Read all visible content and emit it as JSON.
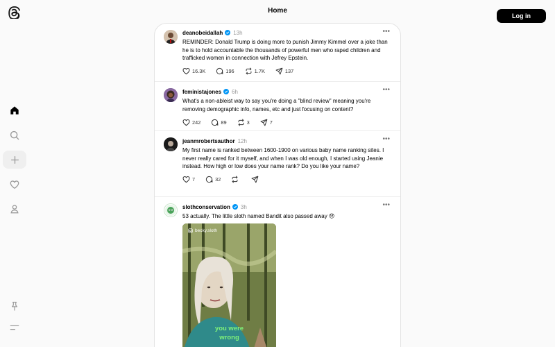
{
  "header": {
    "title": "Home",
    "login_label": "Log in"
  },
  "rail": {
    "icons": [
      "threads-logo-icon",
      "home-icon",
      "search-icon",
      "create-icon",
      "heart-icon",
      "profile-icon",
      "pin-icon",
      "menu-icon"
    ]
  },
  "posts": [
    {
      "username": "deanobeidallah",
      "verified": true,
      "time": "13h",
      "text": "REMINDER: Donald Trump is doing more to punish Jimmy Kimmel over a joke than he is to hold accountable the thousands of powerful men who raped children and trafficked women in connection with Jefrey Epstein.",
      "likes": "16.3K",
      "replies": "196",
      "reposts": "1.7K",
      "shares": "137"
    },
    {
      "username": "feministajones",
      "verified": true,
      "time": "6h",
      "text": "What's a non-ableist way to say you're doing a \"blind review\" meaning you're removing demographic info, names, etc and just focusing on content?",
      "likes": "242",
      "replies": "89",
      "reposts": "3",
      "shares": "7"
    },
    {
      "username": "jeanmrobertsauthor",
      "verified": false,
      "time": "12h",
      "text": "My first name is ranked between 1600-1900 on various baby name ranking sites. I never really cared for it myself, and when I was old enough, I started using Jeanie instead. How high or low does your name rank? Do you like your name?",
      "likes": "7",
      "replies": "32",
      "reposts": "",
      "shares": ""
    },
    {
      "username": "slothconservation",
      "verified": true,
      "time": "3h",
      "text": "53 actually. The little sloth named Bandit also passed away 😞",
      "media": {
        "tag": "becky.sloth",
        "caption_line1": "you were",
        "caption_line2": "wrong"
      }
    }
  ],
  "colors": {
    "accent": "#0095f6",
    "button_bg": "#000000",
    "background": "#fafafa"
  }
}
